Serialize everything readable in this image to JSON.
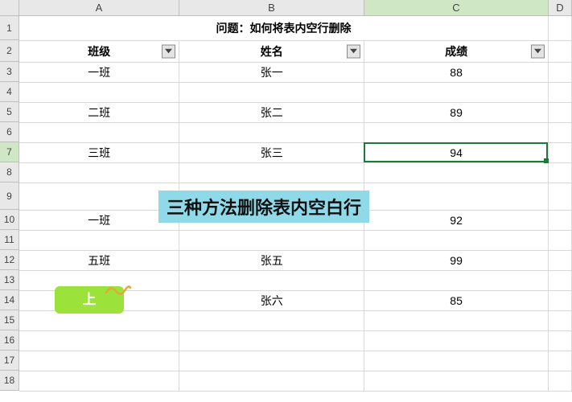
{
  "columns": {
    "A": "A",
    "B": "B",
    "C": "C",
    "D": "D"
  },
  "rowNumbers": [
    "1",
    "2",
    "3",
    "4",
    "5",
    "6",
    "7",
    "8",
    "9",
    "10",
    "11",
    "12",
    "13",
    "14",
    "15",
    "16",
    "17",
    "18"
  ],
  "title": "问题：如何将表内空行删除",
  "headers": {
    "class": "班级",
    "name": "姓名",
    "score": "成绩"
  },
  "rows": [
    {
      "class": "一班",
      "name": "张一",
      "score": "88"
    },
    {
      "class": "",
      "name": "",
      "score": ""
    },
    {
      "class": "二班",
      "name": "张二",
      "score": "89"
    },
    {
      "class": "",
      "name": "",
      "score": ""
    },
    {
      "class": "三班",
      "name": "张三",
      "score": "94"
    },
    {
      "class": "",
      "name": "",
      "score": ""
    },
    {
      "class": "",
      "name": "",
      "score": ""
    },
    {
      "class": "一班",
      "name": "",
      "score": "92"
    },
    {
      "class": "",
      "name": "",
      "score": ""
    },
    {
      "class": "五班",
      "name": "张五",
      "score": "99"
    },
    {
      "class": "",
      "name": "",
      "score": ""
    },
    {
      "class": "",
      "name": "张六",
      "score": "85"
    }
  ],
  "overlay": "三种方法删除表内空白行",
  "callout": "上",
  "selectedCell": "C7",
  "chart_data": {
    "type": "table",
    "title": "问题：如何将表内空行删除",
    "columns": [
      "班级",
      "姓名",
      "成绩"
    ],
    "data": [
      [
        "一班",
        "张一",
        88
      ],
      [
        "二班",
        "张二",
        89
      ],
      [
        "三班",
        "张三",
        94
      ],
      [
        "一班",
        null,
        92
      ],
      [
        "五班",
        "张五",
        99
      ],
      [
        null,
        "张六",
        85
      ]
    ]
  }
}
